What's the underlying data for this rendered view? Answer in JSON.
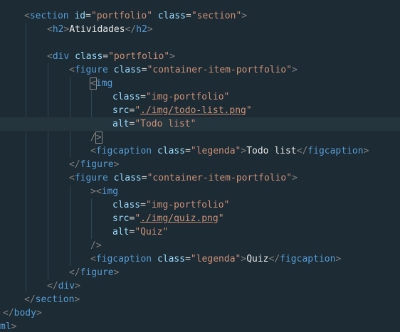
{
  "lines": [
    {
      "indent": 34,
      "tokens": [
        {
          "text": "<",
          "type": "punct"
        },
        {
          "text": "section",
          "type": "tag"
        },
        {
          "text": " ",
          "type": "text"
        },
        {
          "text": "id",
          "type": "attr"
        },
        {
          "text": "=",
          "type": "eq"
        },
        {
          "text": "\"portfolio\"",
          "type": "str"
        },
        {
          "text": " ",
          "type": "text"
        },
        {
          "text": "class",
          "type": "attr"
        },
        {
          "text": "=",
          "type": "eq"
        },
        {
          "text": "\"section\"",
          "type": "str"
        },
        {
          "text": ">",
          "type": "punct"
        }
      ]
    },
    {
      "indent": 66,
      "tokens": [
        {
          "text": "<",
          "type": "punct"
        },
        {
          "text": "h2",
          "type": "tag"
        },
        {
          "text": ">",
          "type": "punct"
        },
        {
          "text": "Atividades",
          "type": "text"
        },
        {
          "text": "</",
          "type": "punct"
        },
        {
          "text": "h2",
          "type": "tag"
        },
        {
          "text": ">",
          "type": "punct"
        }
      ]
    },
    {
      "indent": 0,
      "tokens": []
    },
    {
      "indent": 66,
      "tokens": [
        {
          "text": "<",
          "type": "punct"
        },
        {
          "text": "div",
          "type": "tag"
        },
        {
          "text": " ",
          "type": "text"
        },
        {
          "text": "class",
          "type": "attr"
        },
        {
          "text": "=",
          "type": "eq"
        },
        {
          "text": "\"portfolio\"",
          "type": "str"
        },
        {
          "text": ">",
          "type": "punct"
        }
      ]
    },
    {
      "indent": 97,
      "tokens": [
        {
          "text": "<",
          "type": "punct"
        },
        {
          "text": "figure",
          "type": "tag"
        },
        {
          "text": " ",
          "type": "text"
        },
        {
          "text": "class",
          "type": "attr"
        },
        {
          "text": "=",
          "type": "eq"
        },
        {
          "text": "\"container-item-portfolio\"",
          "type": "str"
        },
        {
          "text": ">",
          "type": "punct"
        }
      ]
    },
    {
      "indent": 127,
      "tokens": [
        {
          "text": "<",
          "type": "punct",
          "box": true
        },
        {
          "text": "img",
          "type": "tag"
        }
      ]
    },
    {
      "indent": 158,
      "tokens": [
        {
          "text": "class",
          "type": "attr"
        },
        {
          "text": "=",
          "type": "eq"
        },
        {
          "text": "\"img-portfolio\"",
          "type": "str"
        }
      ]
    },
    {
      "indent": 158,
      "tokens": [
        {
          "text": "src",
          "type": "attr"
        },
        {
          "text": "=",
          "type": "eq"
        },
        {
          "text": "\"",
          "type": "str"
        },
        {
          "text": "./img/todo-list.png",
          "type": "link"
        },
        {
          "text": "\"",
          "type": "str"
        }
      ]
    },
    {
      "indent": 158,
      "highlight": true,
      "tokens": [
        {
          "text": "alt",
          "type": "attr"
        },
        {
          "text": "=",
          "type": "eq"
        },
        {
          "text": "\"Todo list\"",
          "type": "str"
        }
      ]
    },
    {
      "indent": 127,
      "tokens": [
        {
          "text": "/",
          "type": "punct"
        },
        {
          "text": ">",
          "type": "punct",
          "box": true
        }
      ]
    },
    {
      "indent": 127,
      "tokens": [
        {
          "text": "<",
          "type": "punct"
        },
        {
          "text": "figcaption",
          "type": "tag"
        },
        {
          "text": " ",
          "type": "text"
        },
        {
          "text": "class",
          "type": "attr"
        },
        {
          "text": "=",
          "type": "eq"
        },
        {
          "text": "\"legenda\"",
          "type": "str"
        },
        {
          "text": ">",
          "type": "punct"
        },
        {
          "text": "Todo list",
          "type": "text"
        },
        {
          "text": "</",
          "type": "punct"
        },
        {
          "text": "figcaption",
          "type": "tag"
        },
        {
          "text": ">",
          "type": "punct"
        }
      ]
    },
    {
      "indent": 97,
      "tokens": [
        {
          "text": "</",
          "type": "punct"
        },
        {
          "text": "figure",
          "type": "tag"
        },
        {
          "text": ">",
          "type": "punct"
        }
      ]
    },
    {
      "indent": 97,
      "tokens": [
        {
          "text": "<",
          "type": "punct"
        },
        {
          "text": "figure",
          "type": "tag"
        },
        {
          "text": " ",
          "type": "text"
        },
        {
          "text": "class",
          "type": "attr"
        },
        {
          "text": "=",
          "type": "eq"
        },
        {
          "text": "\"container-item-portfolio\"",
          "type": "str"
        },
        {
          "text": ">",
          "type": "punct"
        }
      ]
    },
    {
      "indent": 127,
      "tokens": [
        {
          "text": "><",
          "type": "punct"
        },
        {
          "text": "img",
          "type": "tag"
        }
      ]
    },
    {
      "indent": 158,
      "tokens": [
        {
          "text": "class",
          "type": "attr"
        },
        {
          "text": "=",
          "type": "eq"
        },
        {
          "text": "\"img-portfolio\"",
          "type": "str"
        }
      ]
    },
    {
      "indent": 158,
      "tokens": [
        {
          "text": "src",
          "type": "attr"
        },
        {
          "text": "=",
          "type": "eq"
        },
        {
          "text": "\"",
          "type": "str"
        },
        {
          "text": "./img/quiz.png",
          "type": "link"
        },
        {
          "text": "\"",
          "type": "str"
        }
      ]
    },
    {
      "indent": 158,
      "tokens": [
        {
          "text": "alt",
          "type": "attr"
        },
        {
          "text": "=",
          "type": "eq"
        },
        {
          "text": "\"Quiz\"",
          "type": "str"
        }
      ]
    },
    {
      "indent": 127,
      "tokens": [
        {
          "text": "/>",
          "type": "punct"
        }
      ]
    },
    {
      "indent": 127,
      "tokens": [
        {
          "text": "<",
          "type": "punct"
        },
        {
          "text": "figcaption",
          "type": "tag"
        },
        {
          "text": " ",
          "type": "text"
        },
        {
          "text": "class",
          "type": "attr"
        },
        {
          "text": "=",
          "type": "eq"
        },
        {
          "text": "\"legenda\"",
          "type": "str"
        },
        {
          "text": ">",
          "type": "punct"
        },
        {
          "text": "Quiz",
          "type": "text"
        },
        {
          "text": "</",
          "type": "punct"
        },
        {
          "text": "figcaption",
          "type": "tag"
        },
        {
          "text": ">",
          "type": "punct"
        }
      ]
    },
    {
      "indent": 97,
      "tokens": [
        {
          "text": "</",
          "type": "punct"
        },
        {
          "text": "figure",
          "type": "tag"
        },
        {
          "text": ">",
          "type": "punct"
        }
      ]
    },
    {
      "indent": 66,
      "tokens": [
        {
          "text": "</",
          "type": "punct"
        },
        {
          "text": "div",
          "type": "tag"
        },
        {
          "text": ">",
          "type": "punct"
        }
      ]
    },
    {
      "indent": 34,
      "tokens": [
        {
          "text": "</",
          "type": "punct"
        },
        {
          "text": "section",
          "type": "tag"
        },
        {
          "text": ">",
          "type": "punct"
        }
      ]
    },
    {
      "indent": 4,
      "tokens": [
        {
          "text": "</",
          "type": "punct"
        },
        {
          "text": "body",
          "type": "tag"
        },
        {
          "text": ">",
          "type": "punct"
        }
      ]
    },
    {
      "indent": 0,
      "tokens": [
        {
          "text": "ml",
          "type": "tag"
        },
        {
          "text": ">",
          "type": "punct"
        }
      ]
    }
  ]
}
